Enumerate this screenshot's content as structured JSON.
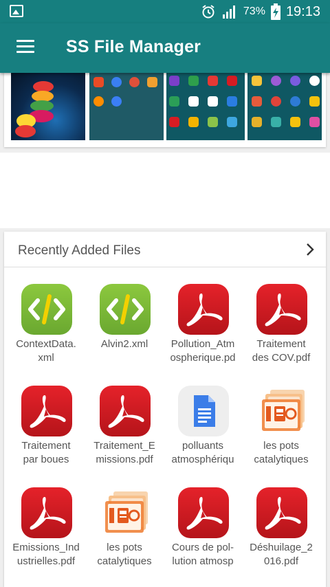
{
  "status": {
    "battery": "73%",
    "time": "19:13"
  },
  "appbar": {
    "title": "SS File Manager"
  },
  "recent": {
    "title": "Recently Added Files",
    "files": [
      {
        "name": "ContextData.\nxml",
        "type": "xml"
      },
      {
        "name": "Alvin2.xml",
        "type": "xml"
      },
      {
        "name": "Pollution_Atm\nospherique.pd",
        "type": "pdf"
      },
      {
        "name": "Traitement\ndes COV.pdf",
        "type": "pdf"
      },
      {
        "name": "Traitement\npar boues",
        "type": "pdf"
      },
      {
        "name": "Traitement_E\nmissions.pdf",
        "type": "pdf"
      },
      {
        "name": "polluants\natmosphériqu",
        "type": "doc"
      },
      {
        "name": "les pots\ncatalytiques",
        "type": "ppt"
      },
      {
        "name": "Emissions_Ind\nustrielles.pdf",
        "type": "pdf"
      },
      {
        "name": "les pots\ncatalytiques",
        "type": "ppt"
      },
      {
        "name": "Cours de pol-\nlution atmosp",
        "type": "pdf"
      },
      {
        "name": "Déshuilage_2\n016.pdf",
        "type": "pdf"
      }
    ]
  },
  "colors": {
    "appbar": "#177f80",
    "pdf": "#d61c23",
    "xml": "#7dbb37"
  }
}
